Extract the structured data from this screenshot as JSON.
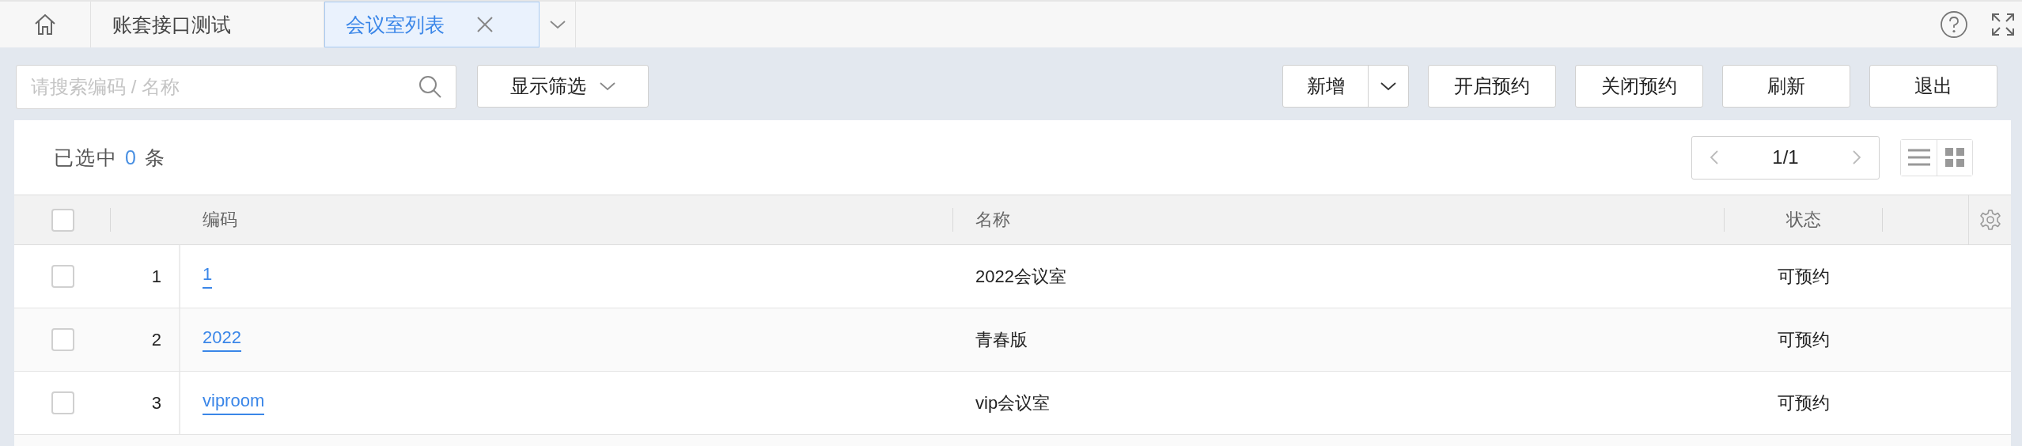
{
  "tabs": [
    {
      "label": "账套接口测试",
      "selected": false
    },
    {
      "label": "会议室列表",
      "selected": true
    }
  ],
  "search": {
    "placeholder": "请搜索编码 / 名称"
  },
  "filter_button": "显示筛选",
  "actions": [
    {
      "label": "新增",
      "kind": "split"
    },
    {
      "label": "开启预约",
      "kind": "plain"
    },
    {
      "label": "关闭预约",
      "kind": "plain"
    },
    {
      "label": "刷新",
      "kind": "plain"
    },
    {
      "label": "退出",
      "kind": "plain"
    }
  ],
  "selection": {
    "prefix": "已选中",
    "count": "0",
    "suffix": "条"
  },
  "pager": "1/1",
  "table": {
    "select_all": {
      "checked": false
    },
    "columns": [
      "编码",
      "名称",
      "状态"
    ],
    "rows": [
      {
        "checked": false,
        "index": "1",
        "code": "1",
        "name": "2022会议室",
        "status": "可预约"
      },
      {
        "checked": false,
        "index": "2",
        "code": "2022",
        "name": "青春版",
        "status": "可预约"
      },
      {
        "checked": false,
        "index": "3",
        "code": "viproom",
        "name": "vip会议室",
        "status": "可预约"
      }
    ]
  }
}
